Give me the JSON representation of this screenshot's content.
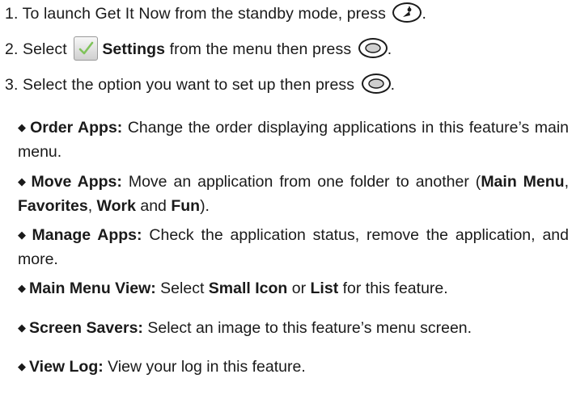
{
  "steps": [
    {
      "number": "1.",
      "text": "To launch Get It Now from the standby mode, press",
      "end": "."
    },
    {
      "number": "2.",
      "pre": "Select",
      "bold": "Settings",
      "post": "from the menu then press",
      "end": "."
    },
    {
      "number": "3.",
      "text": "Select the option you want to set up then press",
      "end": "."
    }
  ],
  "options": [
    {
      "term": "Order Apps:",
      "desc": "Change the order displaying applications in this feature’s main menu."
    },
    {
      "term": "Move Apps:",
      "desc_pre": "Move an application from one folder to another (",
      "folders": [
        "Main Menu",
        "Favorites",
        "Work",
        "Fun"
      ],
      "sep1": ", ",
      "sep2": ", ",
      "sep3": " and ",
      "desc_post": ")."
    },
    {
      "term": "Manage Apps:",
      "desc": "Check the application status, remove the appli­cation, and more."
    },
    {
      "term": "Main Menu View:",
      "desc_pre": "Select",
      "opt1": "Small Icon",
      "mid": "or",
      "opt2": "List",
      "desc_post": "for this feature."
    },
    {
      "term": "Screen Savers:",
      "desc": "Select an image to this feature’s menu screen."
    },
    {
      "term": "View Log:",
      "desc": "View your log in this feature."
    }
  ],
  "icons": {
    "get_it_now_key": "get-it-now-key-icon",
    "ok_key": "ok-key-icon",
    "settings": "settings-checkmark-icon",
    "bullet": "◆"
  }
}
